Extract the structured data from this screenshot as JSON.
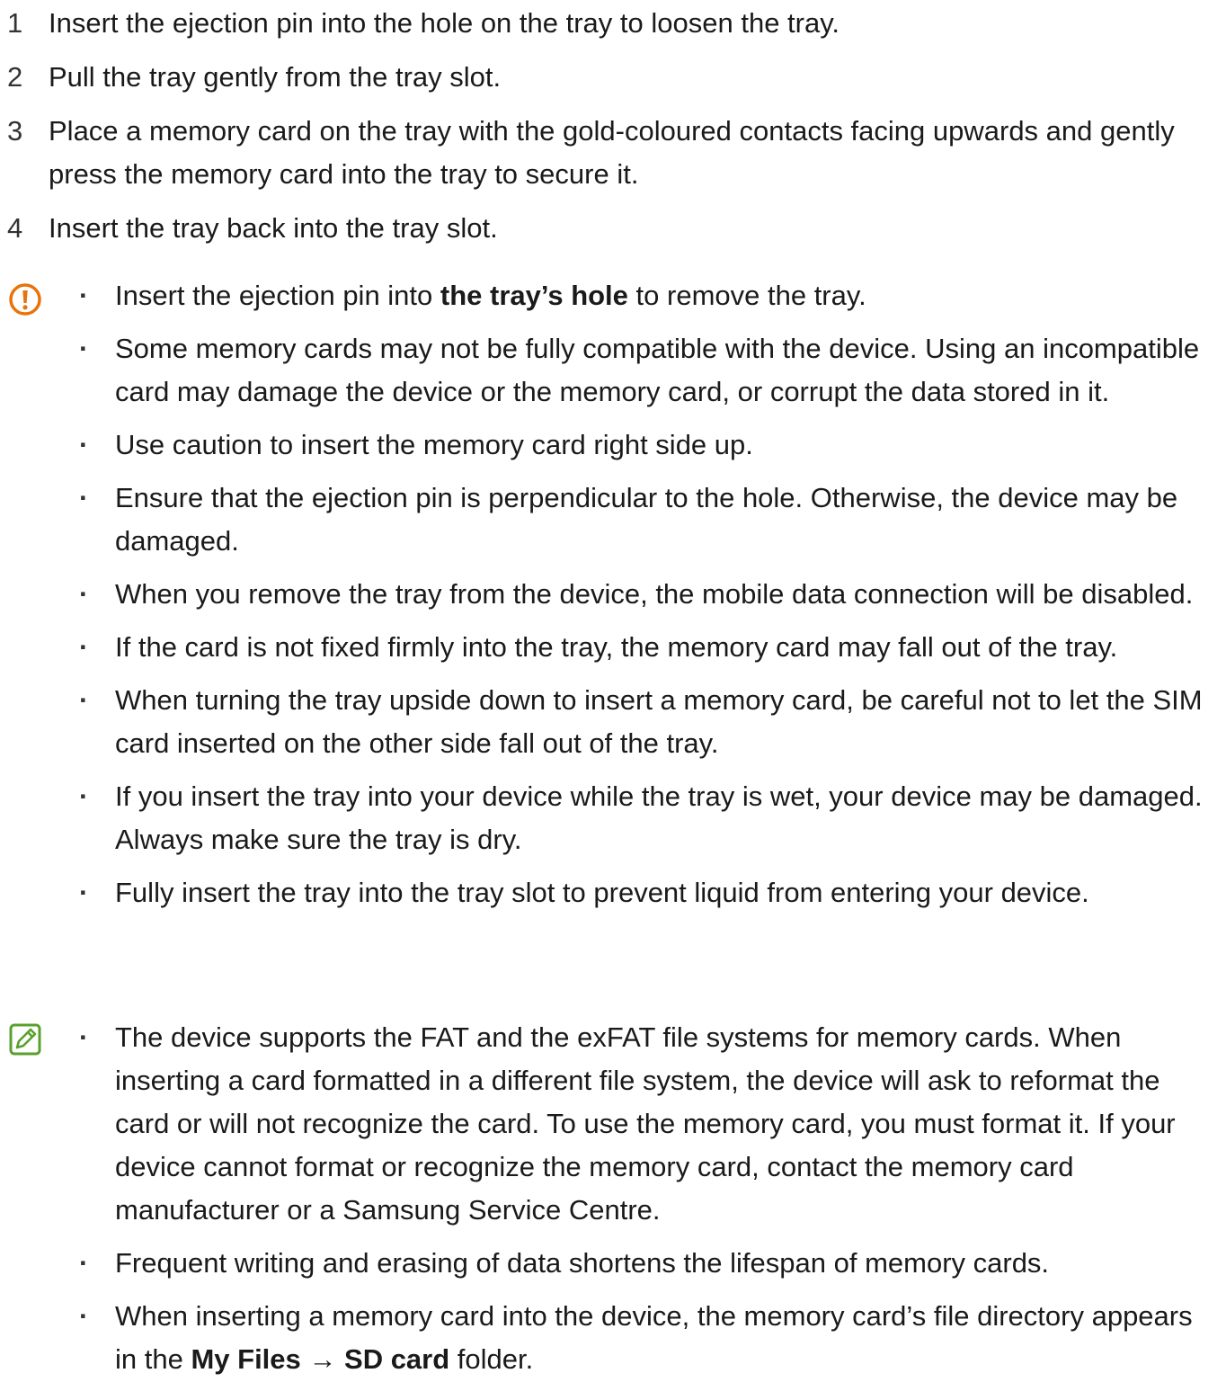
{
  "steps": [
    {
      "num": "1",
      "text": "Insert the ejection pin into the hole on the tray to loosen the tray."
    },
    {
      "num": "2",
      "text": "Pull the tray gently from the tray slot."
    },
    {
      "num": "3",
      "text": "Place a memory card on the tray with the gold-coloured contacts facing upwards and gently press the memory card into the tray to secure it."
    },
    {
      "num": "4",
      "text": "Insert the tray back into the tray slot."
    }
  ],
  "caution": {
    "icon": "caution-icon",
    "icon_color": "#e8730c",
    "first": {
      "before": "Insert the ejection pin into ",
      "bold": "the tray’s hole",
      "after": " to remove the tray."
    },
    "items": [
      "Some memory cards may not be fully compatible with the device. Using an incompatible card may damage the device or the memory card, or corrupt the data stored in it.",
      "Use caution to insert the memory card right side up.",
      "Ensure that the ejection pin is perpendicular to the hole. Otherwise, the device may be damaged.",
      "When you remove the tray from the device, the mobile data connection will be disabled.",
      "If the card is not fixed firmly into the tray, the memory card may fall out of the tray.",
      "When turning the tray upside down to insert a memory card, be careful not to let the SIM card inserted on the other side fall out of the tray.",
      "If you insert the tray into your device while the tray is wet, your device may be damaged. Always make sure the tray is dry.",
      "Fully insert the tray into the tray slot to prevent liquid from entering your device."
    ]
  },
  "note": {
    "icon": "note-icon",
    "icon_color": "#5aa02c",
    "items": [
      "The device supports the FAT and the exFAT file systems for memory cards. When inserting a card formatted in a different file system, the device will ask to reformat the card or will not recognize the card. To use the memory card, you must format it. If your device cannot format or recognize the memory card, contact the memory card manufacturer or a Samsung Service Centre.",
      "Frequent writing and erasing of data shortens the lifespan of memory cards."
    ],
    "last": {
      "before": "When inserting a memory card into the device, the memory card’s file directory appears in the ",
      "bold1": "My Files",
      "arrow": " → ",
      "bold2": "SD card",
      "after": " folder."
    }
  }
}
